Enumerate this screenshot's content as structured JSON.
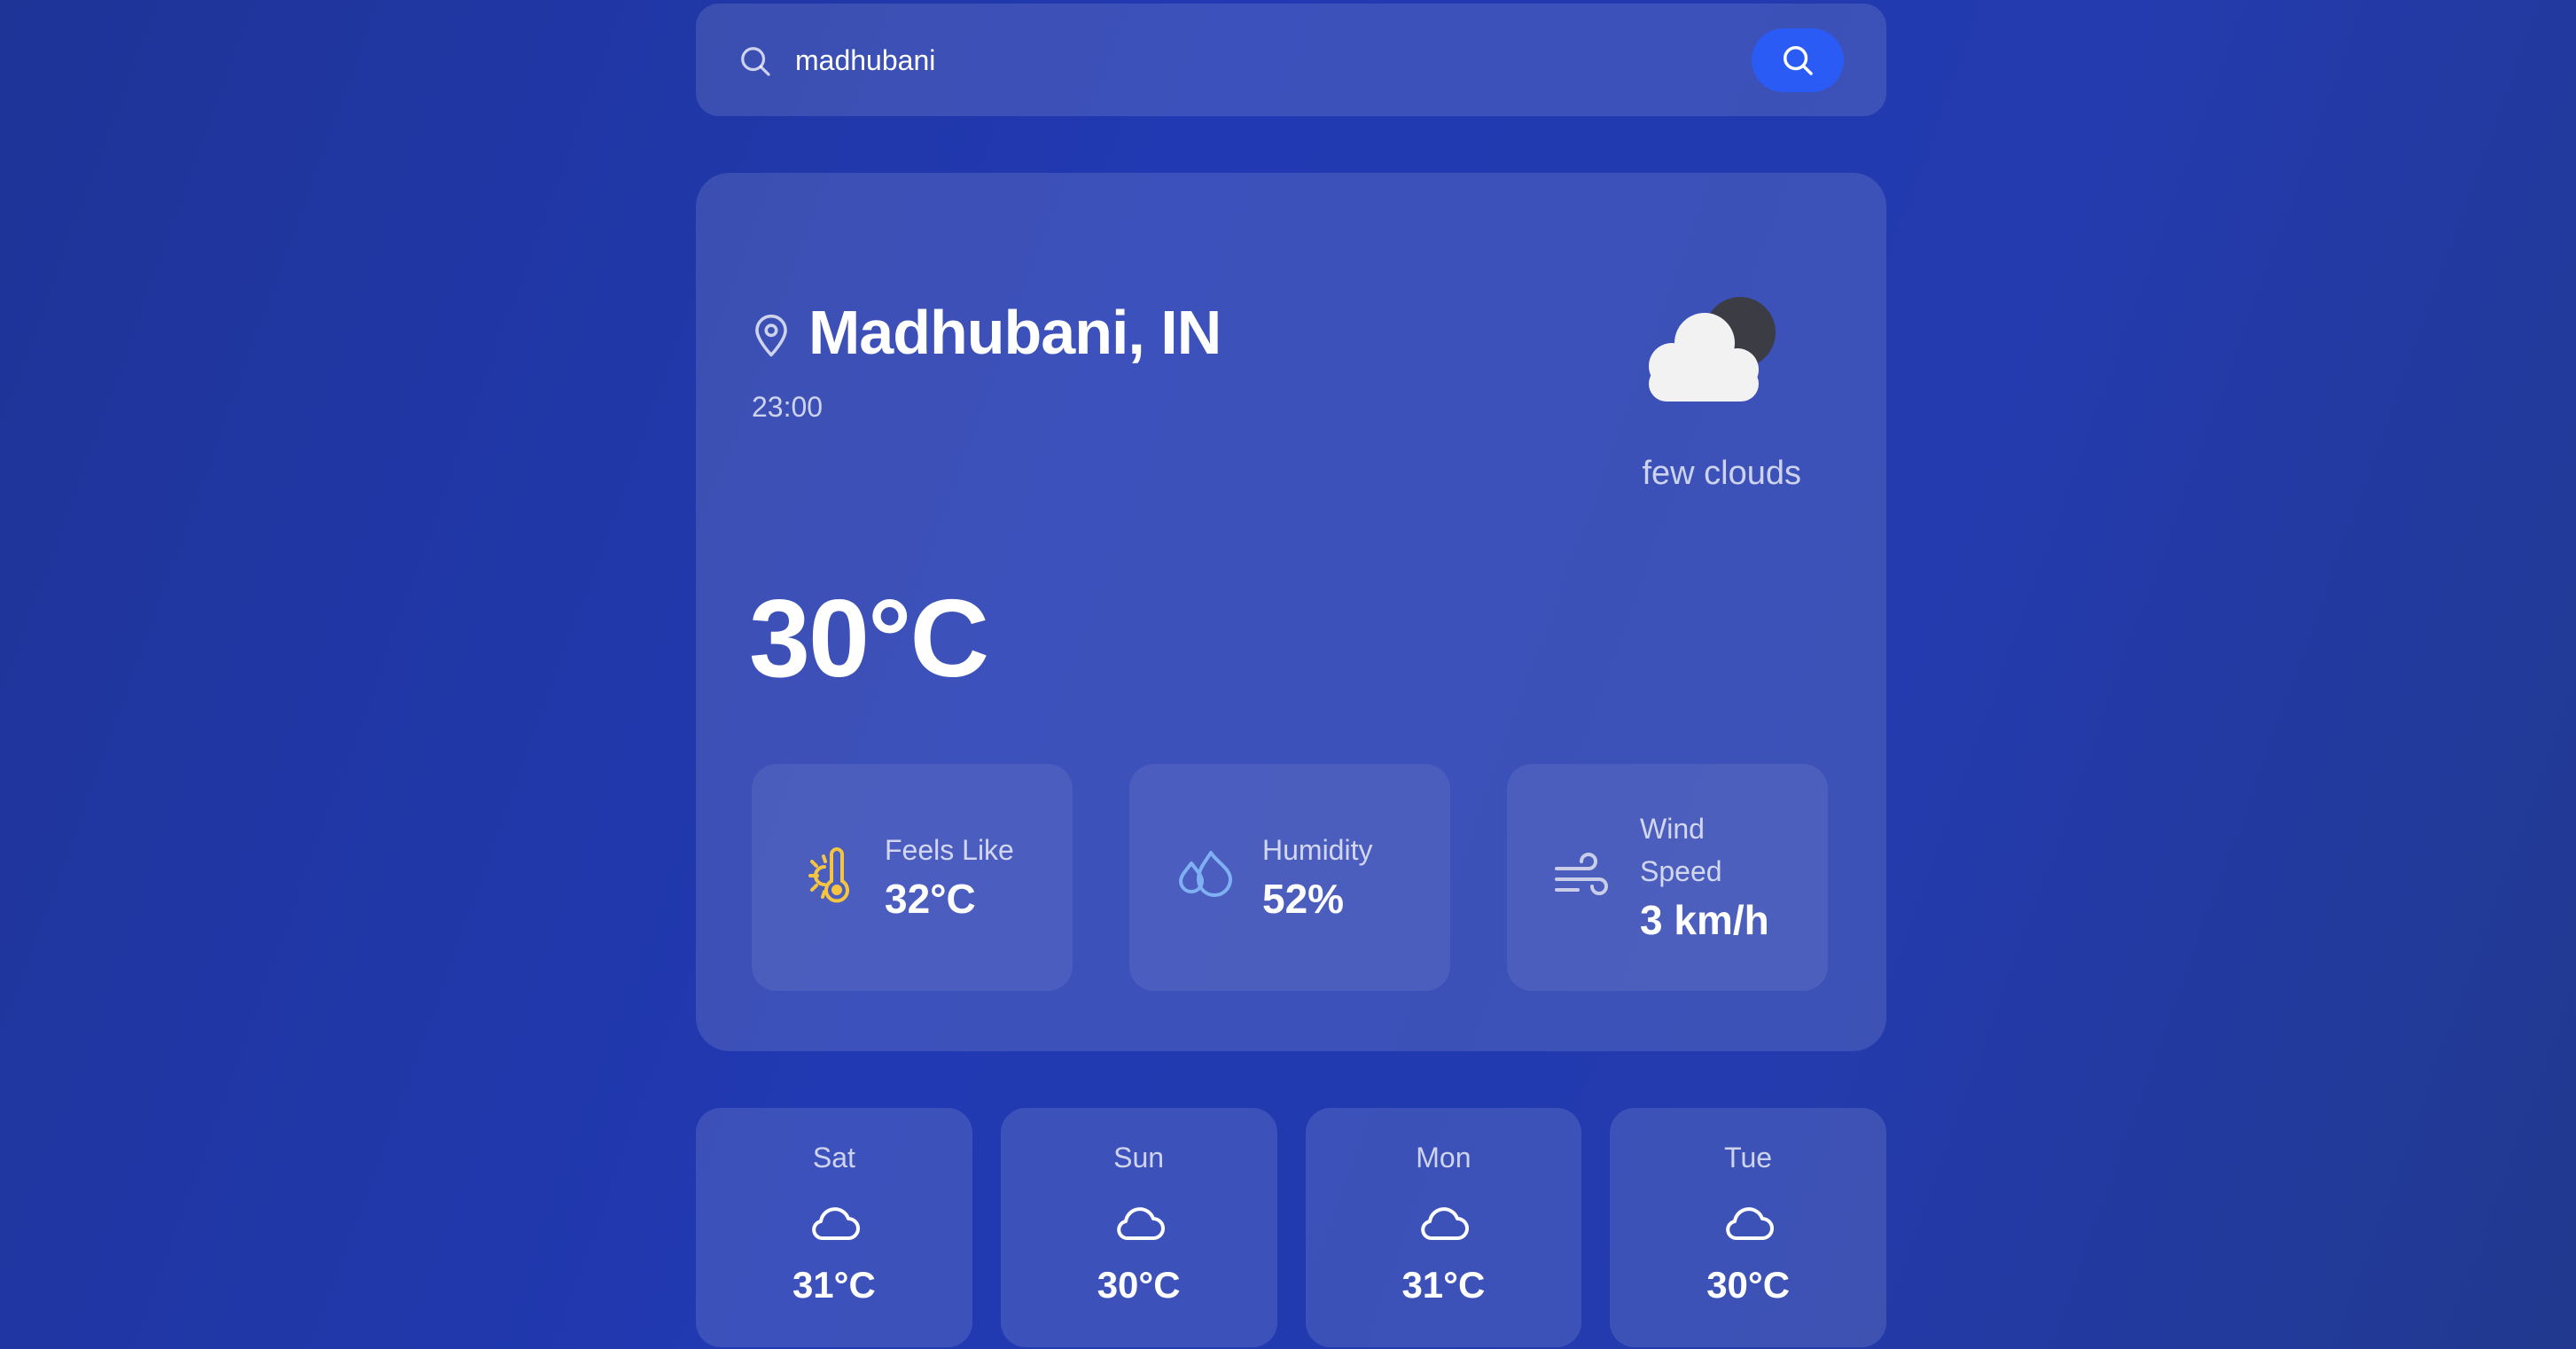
{
  "search": {
    "value": "madhubani",
    "placeholder": ""
  },
  "current": {
    "city": "Madhubani, IN",
    "time": "23:00",
    "description": "few clouds",
    "temperature": "30°C",
    "icon": "cloud-moon-icon"
  },
  "stats": [
    {
      "label": "Feels Like",
      "value": "32°C",
      "icon": "sun-thermometer-icon",
      "color": "#f5c542"
    },
    {
      "label": "Humidity",
      "value": "52%",
      "icon": "droplets-icon",
      "color": "#7fb0f2"
    },
    {
      "label": "Wind Speed",
      "value": "3 km/h",
      "icon": "wind-icon",
      "color": "#c9cde8"
    }
  ],
  "forecast": [
    {
      "day": "Sat",
      "temp": "31°C",
      "icon": "cloud-icon"
    },
    {
      "day": "Sun",
      "temp": "30°C",
      "icon": "cloud-icon"
    },
    {
      "day": "Mon",
      "temp": "31°C",
      "icon": "cloud-icon"
    },
    {
      "day": "Tue",
      "temp": "30°C",
      "icon": "cloud-icon"
    }
  ],
  "colors": {
    "accent": "#2b5bf5",
    "background": "#2139b2"
  }
}
